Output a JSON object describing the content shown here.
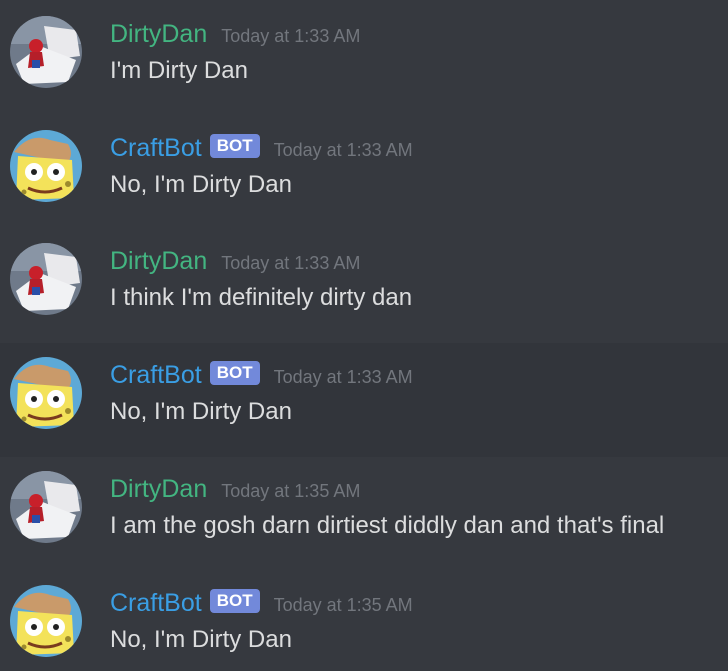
{
  "colors": {
    "background": "#36393f",
    "message_highlight": "#32353b",
    "text": "#dcddde",
    "timestamp": "#72767d",
    "bot_tag": "#7289da"
  },
  "messages": [
    {
      "author": "DirtyDan",
      "author_color": "#43b581",
      "avatar": "spiderman-in-bed-avatar",
      "is_bot": false,
      "bot_tag": "",
      "timestamp": "Today at 1:33 AM",
      "content": "I'm Dirty Dan"
    },
    {
      "author": "CraftBot",
      "author_color": "#3a9ee4",
      "avatar": "spongebob-avatar",
      "is_bot": true,
      "bot_tag": "BOT",
      "timestamp": "Today at 1:33 AM",
      "content": "No, I'm Dirty Dan"
    },
    {
      "author": "DirtyDan",
      "author_color": "#43b581",
      "avatar": "spiderman-in-bed-avatar",
      "is_bot": false,
      "bot_tag": "",
      "timestamp": "Today at 1:33 AM",
      "content": "I think I'm definitely dirty dan"
    },
    {
      "author": "CraftBot",
      "author_color": "#3a9ee4",
      "avatar": "spongebob-avatar",
      "is_bot": true,
      "bot_tag": "BOT",
      "timestamp": "Today at 1:33 AM",
      "content": "No, I'm Dirty Dan"
    },
    {
      "author": "DirtyDan",
      "author_color": "#43b581",
      "avatar": "spiderman-in-bed-avatar",
      "is_bot": false,
      "bot_tag": "",
      "timestamp": "Today at 1:35 AM",
      "content": "I am the gosh darn dirtiest diddly dan and that's final"
    },
    {
      "author": "CraftBot",
      "author_color": "#3a9ee4",
      "avatar": "spongebob-avatar",
      "is_bot": true,
      "bot_tag": "BOT",
      "timestamp": "Today at 1:35 AM",
      "content": "No, I'm Dirty Dan"
    }
  ]
}
